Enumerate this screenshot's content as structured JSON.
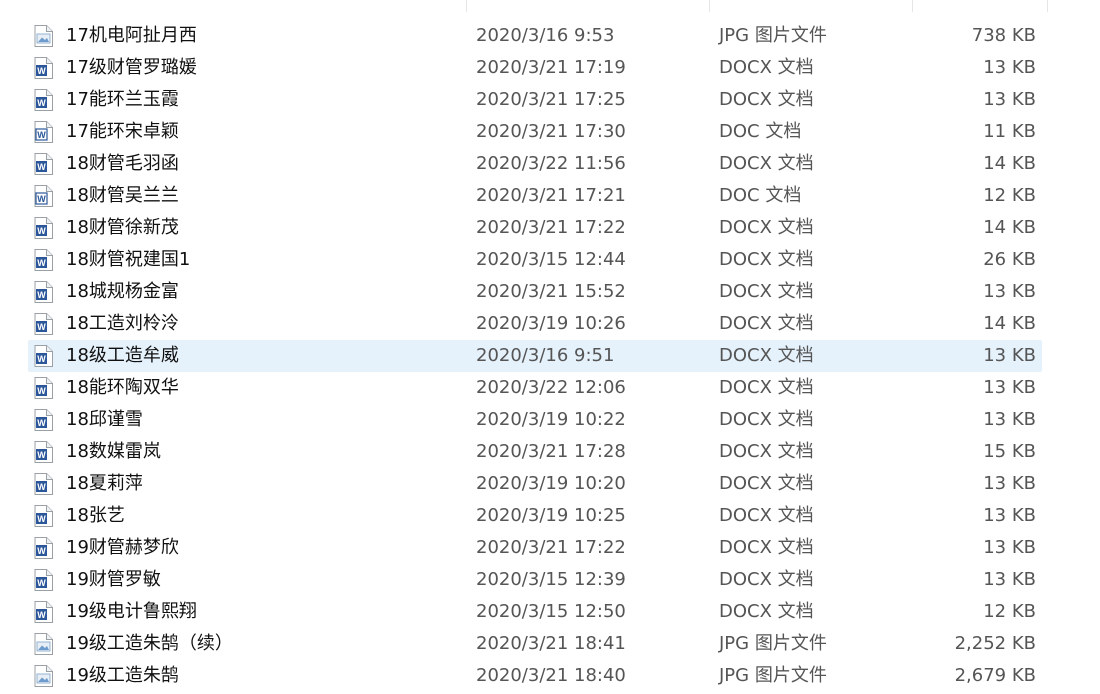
{
  "files": [
    {
      "name": "17机电阿扯月西",
      "date": "2020/3/16 9:53",
      "type": "JPG 图片文件",
      "size": "738 KB",
      "icon": "jpg-file-icon"
    },
    {
      "name": "17级财管罗璐媛",
      "date": "2020/3/21 17:19",
      "type": "DOCX 文档",
      "size": "13 KB",
      "icon": "docx-file-icon"
    },
    {
      "name": "17能环兰玉霞",
      "date": "2020/3/21 17:25",
      "type": "DOCX 文档",
      "size": "13 KB",
      "icon": "docx-file-icon"
    },
    {
      "name": "17能环宋卓颖",
      "date": "2020/3/21 17:30",
      "type": "DOC 文档",
      "size": "11 KB",
      "icon": "doc-file-icon"
    },
    {
      "name": "18财管毛羽函",
      "date": "2020/3/22 11:56",
      "type": "DOCX 文档",
      "size": "14 KB",
      "icon": "docx-file-icon"
    },
    {
      "name": "18财管吴兰兰",
      "date": "2020/3/21 17:21",
      "type": "DOC 文档",
      "size": "12 KB",
      "icon": "doc-file-icon"
    },
    {
      "name": "18财管徐新茂",
      "date": "2020/3/21 17:22",
      "type": "DOCX 文档",
      "size": "14 KB",
      "icon": "docx-file-icon"
    },
    {
      "name": "18财管祝建国1",
      "date": "2020/3/15 12:44",
      "type": "DOCX 文档",
      "size": "26 KB",
      "icon": "docx-file-icon"
    },
    {
      "name": "18城规杨金富",
      "date": "2020/3/21 15:52",
      "type": "DOCX 文档",
      "size": "13 KB",
      "icon": "docx-file-icon"
    },
    {
      "name": "18工造刘柃泠",
      "date": "2020/3/19 10:26",
      "type": "DOCX 文档",
      "size": "14 KB",
      "icon": "docx-file-icon"
    },
    {
      "name": "18级工造牟威",
      "date": "2020/3/16 9:51",
      "type": "DOCX 文档",
      "size": "13 KB",
      "icon": "docx-file-icon",
      "selected": true
    },
    {
      "name": "18能环陶双华",
      "date": "2020/3/22 12:06",
      "type": "DOCX 文档",
      "size": "13 KB",
      "icon": "docx-file-icon"
    },
    {
      "name": "18邱谨雪",
      "date": "2020/3/19 10:22",
      "type": "DOCX 文档",
      "size": "13 KB",
      "icon": "docx-file-icon"
    },
    {
      "name": "18数媒雷岚",
      "date": "2020/3/21 17:28",
      "type": "DOCX 文档",
      "size": "15 KB",
      "icon": "docx-file-icon"
    },
    {
      "name": "18夏莉萍",
      "date": "2020/3/19 10:20",
      "type": "DOCX 文档",
      "size": "13 KB",
      "icon": "docx-file-icon"
    },
    {
      "name": "18张艺",
      "date": "2020/3/19 10:25",
      "type": "DOCX 文档",
      "size": "13 KB",
      "icon": "docx-file-icon"
    },
    {
      "name": "19财管赫梦欣",
      "date": "2020/3/21 17:22",
      "type": "DOCX 文档",
      "size": "13 KB",
      "icon": "docx-file-icon"
    },
    {
      "name": "19财管罗敏",
      "date": "2020/3/15 12:39",
      "type": "DOCX 文档",
      "size": "13 KB",
      "icon": "docx-file-icon"
    },
    {
      "name": "19级电计鲁熙翔",
      "date": "2020/3/15 12:50",
      "type": "DOCX 文档",
      "size": "12 KB",
      "icon": "docx-file-icon"
    },
    {
      "name": "19级工造朱鹄（续）",
      "date": "2020/3/21 18:41",
      "type": "JPG 图片文件",
      "size": "2,252 KB",
      "icon": "jpg-file-icon"
    },
    {
      "name": "19级工造朱鹄",
      "date": "2020/3/21 18:40",
      "type": "JPG 图片文件",
      "size": "2,679 KB",
      "icon": "jpg-file-icon"
    }
  ],
  "colors": {
    "selected_bg": "#e5f1fb",
    "word_blue": "#2b579a",
    "text": "#1a1a1a",
    "muted": "#555555"
  }
}
